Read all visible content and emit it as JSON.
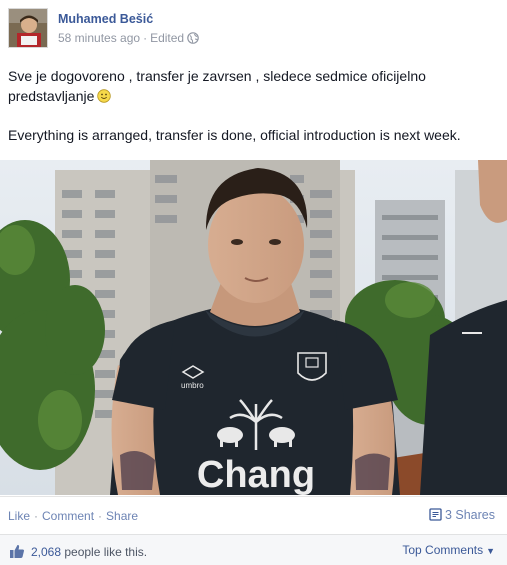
{
  "post": {
    "author": "Muhamed Bešić",
    "timestamp": "58 minutes ago",
    "edited": "Edited",
    "text_line1": "Sve je dogovoreno , transfer je zavrsen , sledece sedmice oficijelno predstavljanje",
    "text_line2": "Everything is arranged, transfer is done, official introduction is next week.",
    "photo_sponsor": "Chang",
    "photo_kit_brand": "umbro"
  },
  "actions": {
    "like": "Like",
    "comment": "Comment",
    "share": "Share",
    "shares_count": "3 Shares"
  },
  "likes": {
    "count": "2,068",
    "suffix": " people like this.",
    "top_comments": "Top Comments"
  },
  "colors": {
    "link": "#3b5998",
    "muted": "#9197a3",
    "shirt": "#1f262e"
  }
}
